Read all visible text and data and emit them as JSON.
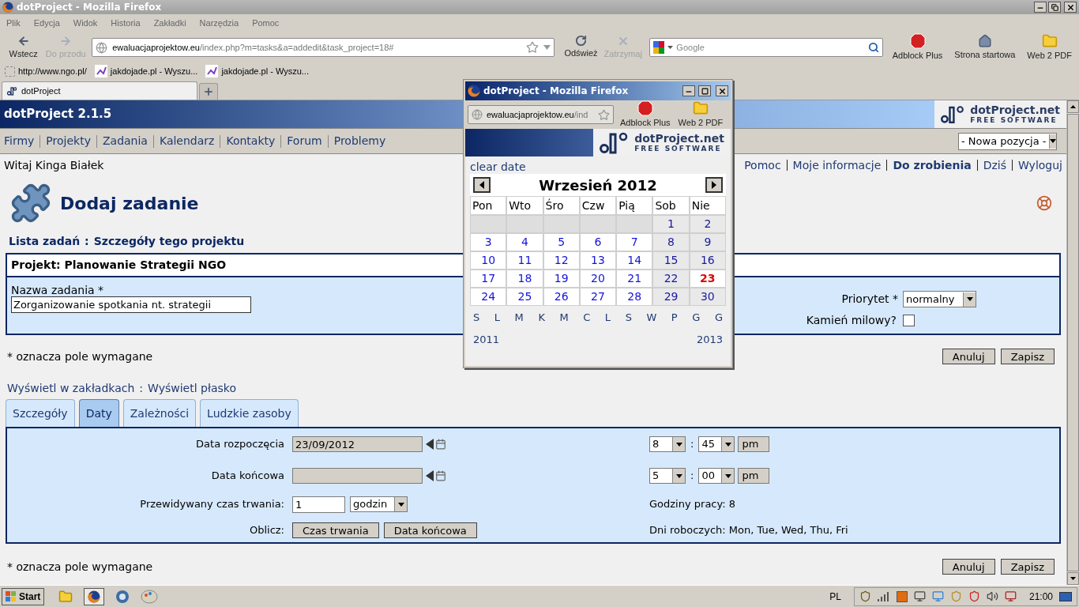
{
  "browser": {
    "title": "dotProject - Mozilla Firefox",
    "menu": [
      "Plik",
      "Edycja",
      "Widok",
      "Historia",
      "Zakładki",
      "Narzędzia",
      "Pomoc"
    ],
    "nav_buttons": [
      {
        "kind": "back",
        "label": "Wstecz",
        "disabled": false
      },
      {
        "kind": "forward",
        "label": "Do przodu",
        "disabled": true
      }
    ],
    "url": {
      "host": "ewaluacjaprojektow.eu",
      "path": "/index.php?m=tasks&a=addedit&task_project=18#"
    },
    "reload": {
      "label": "Odśwież",
      "disabled": false
    },
    "stop": {
      "label": "Zatrzymaj",
      "disabled": true
    },
    "search": {
      "placeholder": "Google"
    },
    "addons": [
      {
        "kind": "adblock",
        "label": "Adblock Plus"
      },
      {
        "kind": "home",
        "label": "Strona startowa"
      },
      {
        "kind": "pdf",
        "label": "Web 2 PDF"
      }
    ],
    "bookmarks": [
      {
        "kind": "blank",
        "label": "http://www.ngo.pl/"
      },
      {
        "kind": "site",
        "label": "jakdojade.pl - Wyszu..."
      },
      {
        "kind": "site",
        "label": "jakdojade.pl - Wyszu..."
      }
    ],
    "tabs": [
      {
        "label": "dotProject",
        "selected": true
      }
    ]
  },
  "page": {
    "app_title": "dotProject 2.1.5",
    "logo": {
      "name": "dotProject.net",
      "tagline": "FREE SOFTWARE"
    },
    "nav": [
      "Firmy",
      "Projekty",
      "Zadania",
      "Kalendarz",
      "Kontakty",
      "Forum",
      "Problemy"
    ],
    "new_item": "- Nowa pozycja -",
    "greeting": "Witaj Kinga Białek",
    "user_links": [
      {
        "label": "Pomoc",
        "current": false
      },
      {
        "label": "Moje informacje",
        "current": false
      },
      {
        "label": "Do zrobienia",
        "current": true
      },
      {
        "label": "Dziś",
        "current": false
      },
      {
        "label": "Wyloguj",
        "current": false
      }
    ],
    "title": "Dodaj zadanie",
    "breadcrumbs": {
      "links": [
        "Lista zadań",
        "Szczegóły tego projektu"
      ],
      "separator": ":"
    },
    "project": "Projekt: Planowanie Strategii NGO",
    "task_name": {
      "label": "Nazwa zadania *",
      "value": "Zorganizowanie spotkania nt. strategii"
    },
    "priority": {
      "label": "Priorytet *",
      "value": "normalny"
    },
    "milestone": {
      "label": "Kamień milowy?",
      "checked": false
    },
    "required_note_top": "* oznacza pole wymagane",
    "buttons_top": [
      "Anuluj",
      "Zapisz"
    ],
    "view_links": {
      "links": [
        "Wyświetl w zakładkach",
        "Wyświetl płasko"
      ],
      "separator": ":"
    },
    "tabs": [
      {
        "label": "Szczegóły",
        "selected": false
      },
      {
        "label": "Daty",
        "selected": true
      },
      {
        "label": "Zależności",
        "selected": false
      },
      {
        "label": "Ludzkie zasoby",
        "selected": false
      }
    ],
    "dates": {
      "start": {
        "label": "Data rozpoczęcia",
        "value": "23/09/2012",
        "hour": "8",
        "minute": "45",
        "ampm": "pm"
      },
      "end": {
        "label": "Data końcowa",
        "hour": "5",
        "minute": "00",
        "ampm": "pm"
      },
      "time_separator": ":",
      "duration": {
        "label": "Przewidywany czas trwania:",
        "value": "1",
        "unit": "godzin"
      },
      "calculate": {
        "label": "Oblicz:",
        "buttons": [
          "Czas trwania",
          "Data końcowa"
        ]
      },
      "work_hours": "Godziny pracy: 8",
      "work_days": "Dni roboczych: Mon, Tue, Wed, Thu, Fri"
    },
    "required_note_bottom": "* oznacza pole wymagane",
    "buttons_bottom": [
      "Anuluj",
      "Zapisz"
    ]
  },
  "popup": {
    "title": "dotProject - Mozilla Firefox",
    "url": {
      "host": "ewaluacjaprojektow.eu",
      "path": "/ind"
    },
    "addons": [
      {
        "kind": "adblock",
        "label": "Adblock Plus"
      },
      {
        "kind": "pdf",
        "label": "Web 2 PDF"
      }
    ],
    "logo": {
      "name": "dotProject.net",
      "tagline": "FREE SOFTWARE"
    },
    "clear_date": "clear date",
    "month": "Wrzesień 2012",
    "weekdays": [
      {
        "label": "Pon",
        "weekend": false
      },
      {
        "label": "Wto",
        "weekend": false
      },
      {
        "label": "Śro",
        "weekend": false
      },
      {
        "label": "Czw",
        "weekend": false
      },
      {
        "label": "Pią",
        "weekend": false
      },
      {
        "label": "Sob",
        "weekend": true
      },
      {
        "label": "Nie",
        "weekend": true
      }
    ],
    "weeks": [
      [
        {
          "kind": "blank"
        },
        {
          "kind": "blank"
        },
        {
          "kind": "blank"
        },
        {
          "kind": "blank"
        },
        {
          "kind": "blank"
        },
        {
          "kind": "day",
          "day": "1",
          "today": false
        },
        {
          "kind": "day",
          "day": "2",
          "today": false
        }
      ],
      [
        {
          "kind": "day",
          "day": "3",
          "today": false
        },
        {
          "kind": "day",
          "day": "4",
          "today": false
        },
        {
          "kind": "day",
          "day": "5",
          "today": false
        },
        {
          "kind": "day",
          "day": "6",
          "today": false
        },
        {
          "kind": "day",
          "day": "7",
          "today": false
        },
        {
          "kind": "day",
          "day": "8",
          "today": false
        },
        {
          "kind": "day",
          "day": "9",
          "today": false
        }
      ],
      [
        {
          "kind": "day",
          "day": "10",
          "today": false
        },
        {
          "kind": "day",
          "day": "11",
          "today": false
        },
        {
          "kind": "day",
          "day": "12",
          "today": false
        },
        {
          "kind": "day",
          "day": "13",
          "today": false
        },
        {
          "kind": "day",
          "day": "14",
          "today": false
        },
        {
          "kind": "day",
          "day": "15",
          "today": false
        },
        {
          "kind": "day",
          "day": "16",
          "today": false
        }
      ],
      [
        {
          "kind": "day",
          "day": "17",
          "today": false
        },
        {
          "kind": "day",
          "day": "18",
          "today": false
        },
        {
          "kind": "day",
          "day": "19",
          "today": false
        },
        {
          "kind": "day",
          "day": "20",
          "today": false
        },
        {
          "kind": "day",
          "day": "21",
          "today": false
        },
        {
          "kind": "day",
          "day": "22",
          "today": false
        },
        {
          "kind": "day",
          "day": "23",
          "today": true
        }
      ],
      [
        {
          "kind": "day",
          "day": "24",
          "today": false
        },
        {
          "kind": "day",
          "day": "25",
          "today": false
        },
        {
          "kind": "day",
          "day": "26",
          "today": false
        },
        {
          "kind": "day",
          "day": "27",
          "today": false
        },
        {
          "kind": "day",
          "day": "28",
          "today": false
        },
        {
          "kind": "day",
          "day": "29",
          "today": false
        },
        {
          "kind": "day",
          "day": "30",
          "today": false
        }
      ]
    ],
    "month_letters": [
      "S",
      "L",
      "M",
      "K",
      "M",
      "C",
      "L",
      "S",
      "W",
      "P",
      "G",
      "G"
    ],
    "prev_year": "2011",
    "next_year": "2013"
  },
  "taskbar": {
    "start": "Start",
    "language": "PL",
    "clock": "21:00"
  }
}
